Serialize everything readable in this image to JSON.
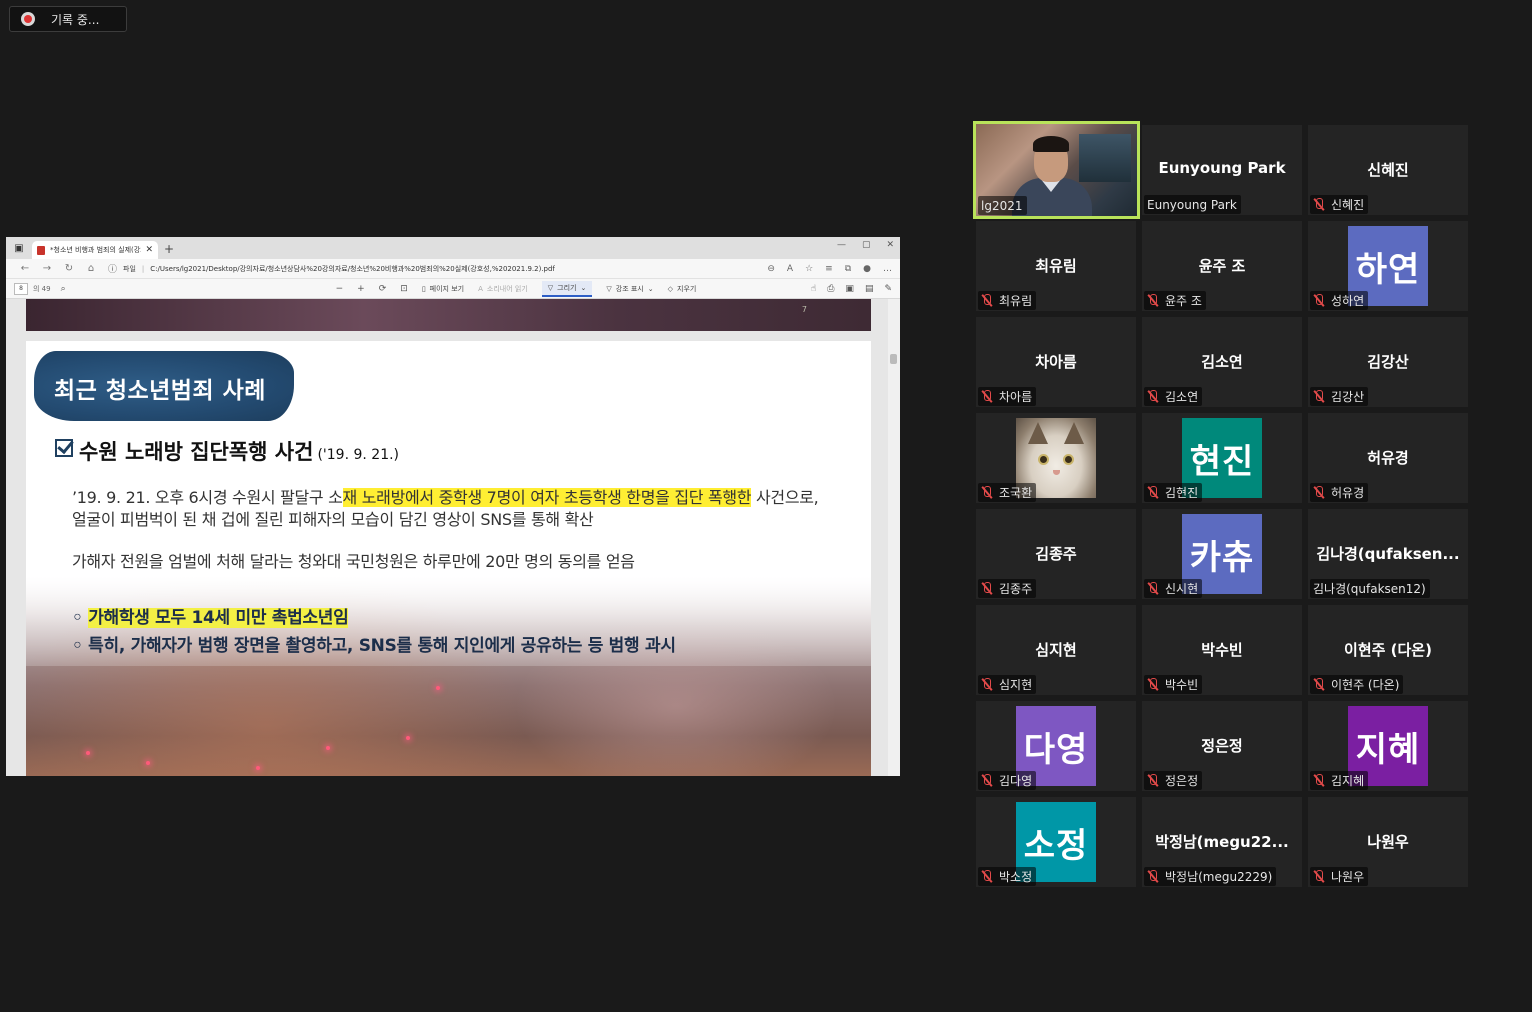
{
  "recording": {
    "label": "기록 중..."
  },
  "browser": {
    "tab_title": "*청소년 비행과 범죄의 실제(강의",
    "address_file_label": "파일",
    "address_url": "C:/Users/lg2021/Desktop/강의자료/청소년상담사%20강의자료/청소년%20비행과%20범죄의%20실제(강호성,%202021.9.2).pdf",
    "page_current": "8",
    "page_total": "의 49",
    "toolbar": {
      "page_view": "페이지 보기",
      "read_aloud": "소리내어 읽기",
      "draw": "그리기",
      "highlight": "강조 표시",
      "erase": "지우기"
    }
  },
  "pdf": {
    "prev_page_number": "7",
    "slide": {
      "banner_title": "최근 청소년범죄 사례",
      "case_title": "수원 노래방 집단폭행 사건",
      "case_date": "('19. 9. 21.)",
      "line1_pre": "’19. 9. 21. 오후 6시경 수원시 팔달구 소",
      "line1_hl": "재 노래방에서 중학생 7명이 여자 초등학생 한명을 집단 폭행한",
      "line1_post": " 사건으로,",
      "line2": "얼굴이 피범벅이 된 채 겁에 질린 피해자의 모습이 담긴 영상이 SNS를 통해 확산",
      "line3": "가해자 전원을 엄벌에 처해 달라는 청와대 국민청원은 하루만에 20만 명의 동의를 얻음",
      "bullet1_mark": "◦ ",
      "bullet1": "가해학생 모두 14세 미만 촉법소년임",
      "bullet2": "◦ 특히, 가해자가 범행 장면을 촬영하고, SNS를 통해 지인에게 공유하는 등 범행 과시"
    }
  },
  "participants": [
    {
      "name": "lg2021",
      "type": "video",
      "muted": false
    },
    {
      "name": "Eunyoung Park",
      "center": "Eunyoung Park",
      "type": "name",
      "muted": false
    },
    {
      "name": "신혜진",
      "center": "신혜진",
      "type": "name",
      "muted": true
    },
    {
      "name": "최유림",
      "center": "최유림",
      "type": "name",
      "muted": true
    },
    {
      "name": "윤주 조",
      "center": "윤주 조",
      "type": "name",
      "muted": true
    },
    {
      "name": "성하연",
      "avatar": "하연",
      "color": "#5c6bc0",
      "type": "avatar",
      "muted": true
    },
    {
      "name": "차아름",
      "center": "차아름",
      "type": "name",
      "muted": true
    },
    {
      "name": "김소연",
      "center": "김소연",
      "type": "name",
      "muted": true
    },
    {
      "name": "김강산",
      "center": "김강산",
      "type": "name",
      "muted": true
    },
    {
      "name": "조국환",
      "type": "photo",
      "muted": true
    },
    {
      "name": "김현진",
      "avatar": "현진",
      "color": "#00897b",
      "type": "avatar",
      "muted": true
    },
    {
      "name": "허유경",
      "center": "허유경",
      "type": "name",
      "muted": true
    },
    {
      "name": "김종주",
      "center": "김종주",
      "type": "name",
      "muted": true
    },
    {
      "name": "신시현",
      "avatar": "카츄",
      "color": "#5c6bc0",
      "type": "avatar",
      "muted": true
    },
    {
      "name": "김나경(qufaksen12)",
      "center": "김나경(qufaksen...",
      "type": "name",
      "muted": false
    },
    {
      "name": "심지현",
      "center": "심지현",
      "type": "name",
      "muted": true
    },
    {
      "name": "박수빈",
      "center": "박수빈",
      "type": "name",
      "muted": true
    },
    {
      "name": "이현주 (다온)",
      "center": "이현주 (다온)",
      "type": "name",
      "muted": true
    },
    {
      "name": "김다영",
      "avatar": "다영",
      "color": "#7e57c2",
      "type": "avatar",
      "muted": true
    },
    {
      "name": "정은정",
      "center": "정은정",
      "type": "name",
      "muted": true
    },
    {
      "name": "김지혜",
      "avatar": "지혜",
      "color": "#7b1fa2",
      "type": "avatar",
      "muted": true
    },
    {
      "name": "박소정",
      "avatar": "소정",
      "color": "#0097a7",
      "type": "avatar",
      "muted": true
    },
    {
      "name": "박정남(megu2229)",
      "center": "박정남(megu22...",
      "type": "name",
      "muted": true
    },
    {
      "name": "나원우",
      "center": "나원우",
      "type": "name",
      "muted": true
    }
  ]
}
